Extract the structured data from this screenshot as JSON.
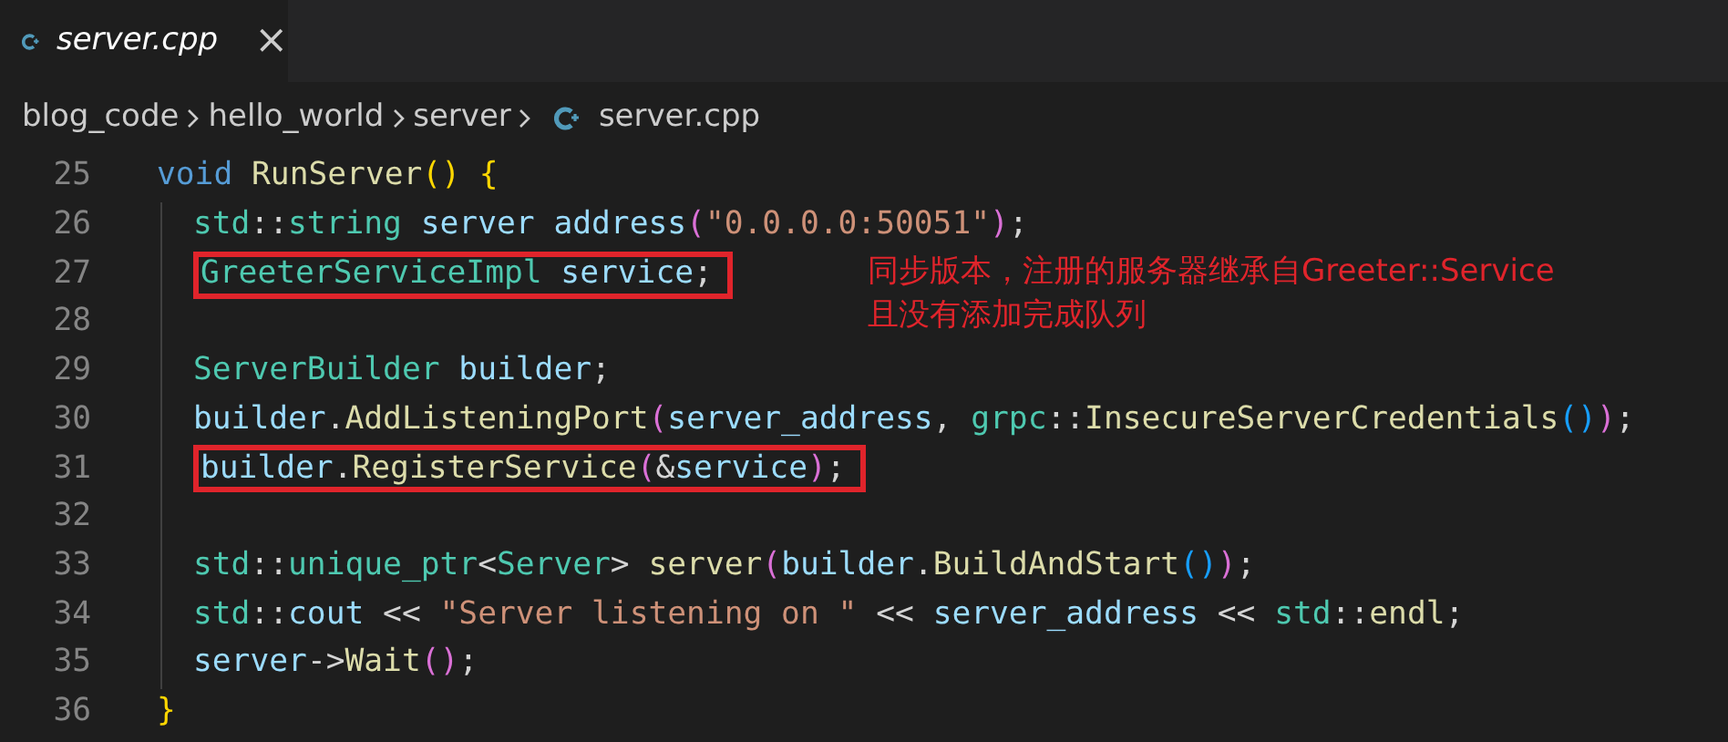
{
  "tab": {
    "label": "server.cpp",
    "close": "×",
    "selected": true
  },
  "breadcrumbs": [
    "blog_code",
    "hello_world",
    "server",
    "server.cpp"
  ],
  "lines": [
    {
      "number": "25",
      "indent": false,
      "highlight": false,
      "tokens": [
        {
          "text": "void ",
          "kind": "keyword"
        },
        {
          "text": "RunServer",
          "kind": "function"
        },
        {
          "text": "() {",
          "kind": "bracket1"
        }
      ]
    },
    {
      "number": "26",
      "indent": true,
      "highlight": false,
      "tokens": [
        {
          "text": "std",
          "kind": "type"
        },
        {
          "text": "::",
          "kind": "plain"
        },
        {
          "text": "string",
          "kind": "type"
        },
        {
          "text": " server address",
          "kind": "variable"
        },
        {
          "text": "(",
          "kind": "bracket2"
        },
        {
          "text": "\"0.0.0.0:50051\"",
          "kind": "string"
        },
        {
          "text": ")",
          "kind": "bracket2"
        },
        {
          "text": ";",
          "kind": "plain"
        }
      ]
    },
    {
      "number": "27",
      "indent": true,
      "highlight": true,
      "tokens": [
        {
          "text": "GreeterServiceImpl",
          "kind": "type"
        },
        {
          "text": " service",
          "kind": "variable"
        },
        {
          "text": ";",
          "kind": "plain"
        }
      ]
    },
    {
      "number": "28",
      "indent": true,
      "highlight": false
    },
    {
      "number": "29",
      "indent": true,
      "highlight": false,
      "tokens": [
        {
          "text": "ServerBuilder",
          "kind": "type"
        },
        {
          "text": " builder",
          "kind": "variable"
        },
        {
          "text": ";",
          "kind": "plain"
        }
      ]
    },
    {
      "number": "30",
      "indent": true,
      "highlight": false,
      "tokens": [
        {
          "text": "builder",
          "kind": "variable"
        },
        {
          "text": ".",
          "kind": "plain"
        },
        {
          "text": "AddListeningPort",
          "kind": "function"
        },
        {
          "text": "(",
          "kind": "bracket2"
        },
        {
          "text": "server_address",
          "kind": "variable"
        },
        {
          "text": ", ",
          "kind": "plain"
        },
        {
          "text": "grpc",
          "kind": "type"
        },
        {
          "text": "::",
          "kind": "plain"
        },
        {
          "text": "InsecureServerCredentials",
          "kind": "function"
        },
        {
          "text": "()",
          "kind": "bracket3"
        },
        {
          "text": ")",
          "kind": "bracket2"
        },
        {
          "text": ";",
          "kind": "plain"
        }
      ]
    },
    {
      "number": "31",
      "indent": true,
      "highlight": true,
      "tokens": [
        {
          "text": "builder",
          "kind": "variable"
        },
        {
          "text": ".",
          "kind": "plain"
        },
        {
          "text": "RegisterService",
          "kind": "function"
        },
        {
          "text": "(",
          "kind": "bracket2"
        },
        {
          "text": "&",
          "kind": "plain"
        },
        {
          "text": "service",
          "kind": "variable"
        },
        {
          "text": ")",
          "kind": "bracket2"
        },
        {
          "text": ";",
          "kind": "plain"
        }
      ]
    },
    {
      "number": "32",
      "indent": true,
      "highlight": false
    },
    {
      "number": "33",
      "indent": true,
      "highlight": false,
      "tokens": [
        {
          "text": "std",
          "kind": "type"
        },
        {
          "text": "::",
          "kind": "plain"
        },
        {
          "text": "unique_ptr",
          "kind": "type"
        },
        {
          "text": "<",
          "kind": "plain"
        },
        {
          "text": "Server",
          "kind": "type"
        },
        {
          "text": "> ",
          "kind": "plain"
        },
        {
          "text": "server",
          "kind": "function"
        },
        {
          "text": "(",
          "kind": "bracket2"
        },
        {
          "text": "builder",
          "kind": "variable"
        },
        {
          "text": ".",
          "kind": "plain"
        },
        {
          "text": "BuildAndStart",
          "kind": "function"
        },
        {
          "text": "()",
          "kind": "bracket3"
        },
        {
          "text": ")",
          "kind": "bracket2"
        },
        {
          "text": ";",
          "kind": "plain"
        }
      ]
    },
    {
      "number": "34",
      "indent": true,
      "highlight": false,
      "tokens": [
        {
          "text": "std",
          "kind": "type"
        },
        {
          "text": "::",
          "kind": "plain"
        },
        {
          "text": "cout",
          "kind": "variable"
        },
        {
          "text": " << ",
          "kind": "plain"
        },
        {
          "text": "\"Server listening on \"",
          "kind": "string"
        },
        {
          "text": " << ",
          "kind": "plain"
        },
        {
          "text": "server_address",
          "kind": "variable"
        },
        {
          "text": " << ",
          "kind": "plain"
        },
        {
          "text": "std",
          "kind": "type"
        },
        {
          "text": "::",
          "kind": "plain"
        },
        {
          "text": "endl",
          "kind": "function"
        },
        {
          "text": ";",
          "kind": "plain"
        }
      ]
    },
    {
      "number": "35",
      "indent": true,
      "highlight": false,
      "tokens": [
        {
          "text": "server",
          "kind": "variable"
        },
        {
          "text": "->",
          "kind": "plain"
        },
        {
          "text": "Wait",
          "kind": "function"
        },
        {
          "text": "()",
          "kind": "bracket2"
        },
        {
          "text": ";",
          "kind": "plain"
        }
      ]
    },
    {
      "number": "36",
      "indent": false,
      "highlight": false,
      "tokens": [
        {
          "text": "}",
          "kind": "bracket1"
        }
      ]
    }
  ],
  "annotation": {
    "lines": [
      "同步版本，注册的服务器继承自Greeter::Service",
      "且没有添加完成队列"
    ]
  }
}
